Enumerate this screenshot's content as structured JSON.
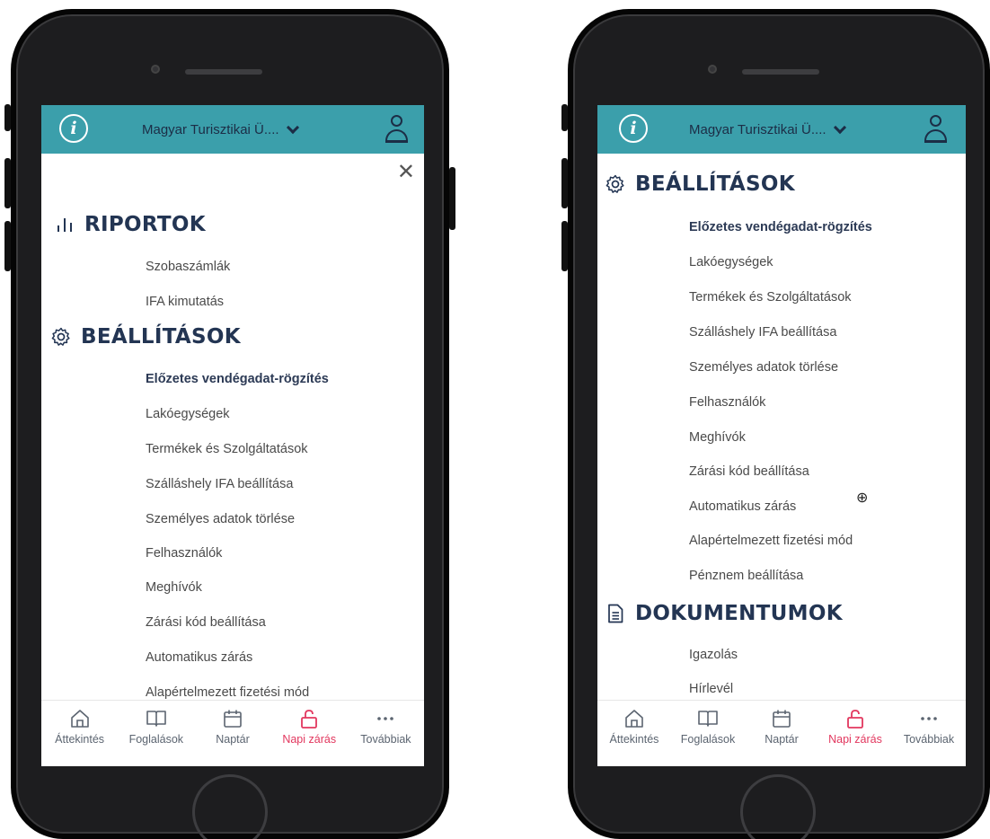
{
  "topbar": {
    "org_name": "Magyar Turisztikai Ü...."
  },
  "menu": {
    "riportok": {
      "title": "RIPORTOK",
      "items": [
        "Szobaszámlák",
        "IFA kimutatás"
      ]
    },
    "beallitasok": {
      "title": "BEÁLLÍTÁSOK",
      "items": [
        "Előzetes vendégadat-rögzítés",
        "Lakóegységek",
        "Termékek és Szolgáltatások",
        "Szálláshely IFA beállítása",
        "Személyes adatok törlése",
        "Felhasználók",
        "Meghívók",
        "Zárási kód beállítása",
        "Automatikus zárás",
        "Alapértelmezett fizetési mód",
        "Pénznem beállítása"
      ]
    },
    "dokumentumok": {
      "title": "DOKUMENTUMOK",
      "items": [
        "Igazolás",
        "Hírlevél"
      ]
    }
  },
  "tabs": [
    {
      "label": "Áttekintés",
      "icon": "home-icon"
    },
    {
      "label": "Foglalások",
      "icon": "book-icon"
    },
    {
      "label": "Naptár",
      "icon": "calendar-icon"
    },
    {
      "label": "Napi zárás",
      "icon": "unlock-icon",
      "active": true
    },
    {
      "label": "Továbbiak",
      "icon": "more-icon"
    }
  ],
  "colors": {
    "topbar": "#3b9fab",
    "heading": "#233553",
    "active_tab": "#e2375e"
  }
}
